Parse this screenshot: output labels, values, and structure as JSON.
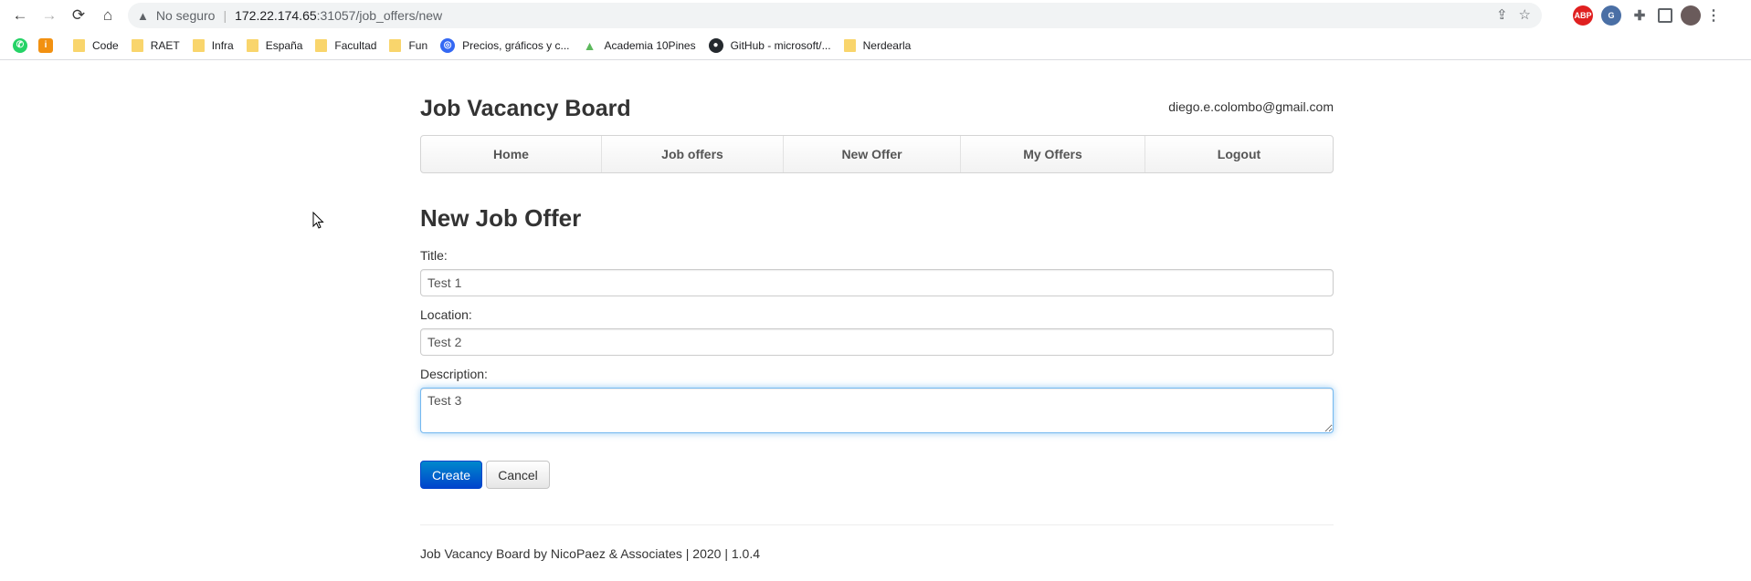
{
  "browser": {
    "address": {
      "security_warning": "No seguro",
      "host": "172.22.174.65",
      "path": ":31057/job_offers/new"
    },
    "bookmarks": [
      {
        "label": "",
        "icon": "whatsapp-icon",
        "color": "#25d366"
      },
      {
        "label": "",
        "icon": "info-icon",
        "color": "#f29111"
      },
      {
        "label": "Code",
        "icon": "folder-icon"
      },
      {
        "label": "RAET",
        "icon": "folder-icon"
      },
      {
        "label": "Infra",
        "icon": "folder-icon"
      },
      {
        "label": "España",
        "icon": "folder-icon"
      },
      {
        "label": "Facultad",
        "icon": "folder-icon"
      },
      {
        "label": "Fun",
        "icon": "folder-icon"
      },
      {
        "label": "Precios, gráficos y c...",
        "icon": "coingecko-icon",
        "color": "#3468f3"
      },
      {
        "label": "Academia 10Pines",
        "icon": "tree-icon",
        "color": "#5cb85c"
      },
      {
        "label": "GitHub - microsoft/...",
        "icon": "github-icon",
        "color": "#24292e"
      },
      {
        "label": "Nerdearla",
        "icon": "folder-icon"
      }
    ]
  },
  "app": {
    "brand": "Job Vacancy Board",
    "user_email": "diego.e.colombo@gmail.com",
    "nav": [
      "Home",
      "Job offers",
      "New Offer",
      "My Offers",
      "Logout"
    ]
  },
  "form": {
    "title": "New Job Offer",
    "title_label": "Title:",
    "title_value": "Test 1",
    "location_label": "Location:",
    "location_value": "Test 2",
    "description_label": "Description:",
    "description_value": "Test 3",
    "create_label": "Create",
    "cancel_label": "Cancel"
  },
  "footer": "Job Vacancy Board by NicoPaez & Associates | 2020 | 1.0.4",
  "colors": {
    "primary": "#0055cc",
    "focus_glow": "#52a8ec"
  }
}
